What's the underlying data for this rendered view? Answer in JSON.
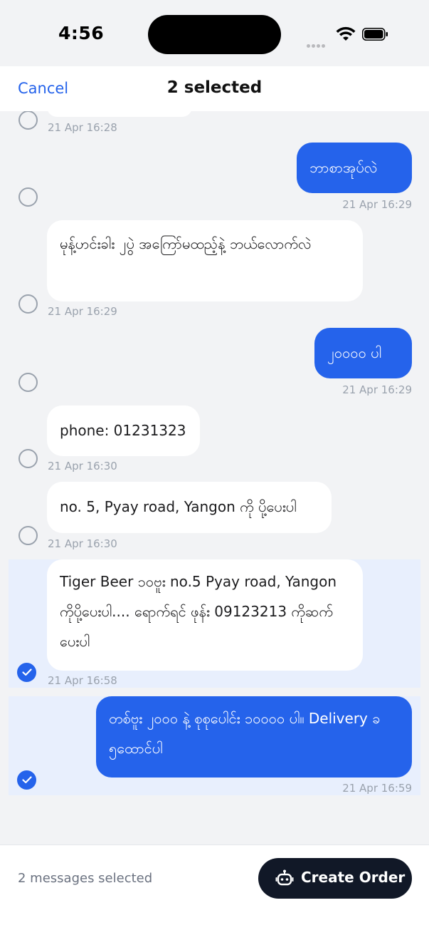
{
  "status_bar": {
    "time": "4:56"
  },
  "header": {
    "cancel_label": "Cancel",
    "title": "2 selected"
  },
  "messages": [
    {
      "text": "",
      "timestamp": "21 Apr 16:28",
      "direction": "in",
      "selected": false
    },
    {
      "text": "ဘာစာအုပ်လဲ",
      "timestamp": "21 Apr 16:29",
      "direction": "out",
      "selected": false
    },
    {
      "text": "မုန့်ဟင်းခါး ၂ပွဲ အကြော်မထည့်နဲ့ ဘယ်လောက်လဲ",
      "timestamp": "21 Apr 16:29",
      "direction": "in",
      "selected": false
    },
    {
      "text": "၂၀၀၀၀ ပါ",
      "timestamp": "21 Apr 16:29",
      "direction": "out",
      "selected": false
    },
    {
      "text": "phone: 01231323",
      "timestamp": "21 Apr 16:30",
      "direction": "in",
      "selected": false
    },
    {
      "text": "no. 5, Pyay road, Yangon ကို ပို့ပေးပါ",
      "timestamp": "21 Apr 16:30",
      "direction": "in",
      "selected": false
    },
    {
      "text": "Tiger Beer ၁၀ဗူး no.5 Pyay road, Yangon ကိုပို့ပေးပါ.... ရောက်ရင် ဖုန်း 09123213 ကိုဆက်ပေးပါ",
      "timestamp": "21 Apr 16:58",
      "direction": "in",
      "selected": true
    },
    {
      "text": "တစ်ဗူး ၂၀၀၀ နဲ့ စုစုပေါင်း ၁၀၀၀၀ ပါ။ Delivery ခ ၅ထောင်ပါ",
      "timestamp": "21 Apr 16:59",
      "direction": "out",
      "selected": true
    }
  ],
  "footer": {
    "selection_count": "2 messages selected",
    "create_order_label": "Create Order"
  },
  "icons": {
    "check": "check-icon",
    "robot": "robot-icon",
    "wifi": "wifi-icon",
    "battery": "battery-icon",
    "signal": "signal-dots-icon"
  },
  "colors": {
    "accent": "#2563eb",
    "dark_button": "#111827",
    "selected_row": "#e8effd",
    "background": "#f2f3f5"
  }
}
